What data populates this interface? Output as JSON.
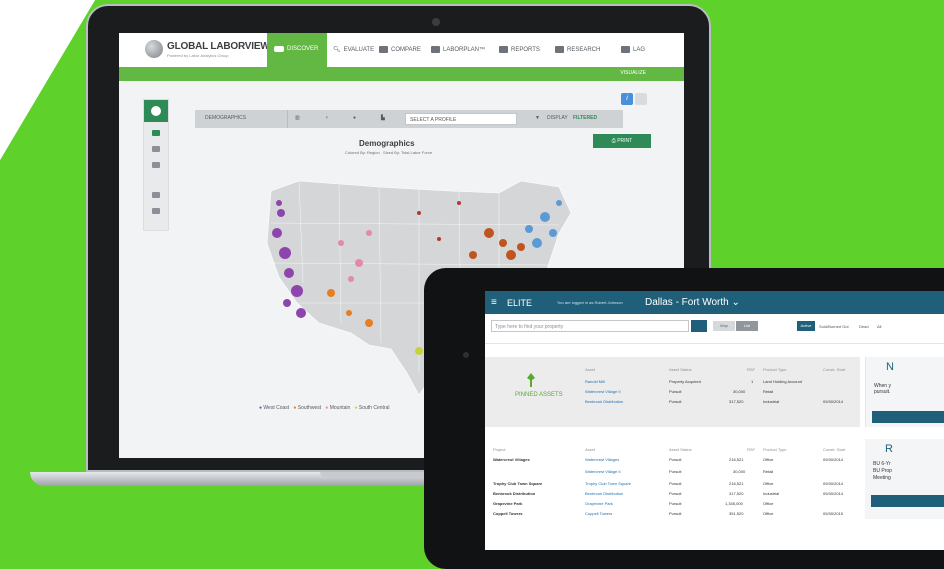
{
  "laptop": {
    "logo": {
      "title": "GLOBAL LABORVIEW",
      "subtitle": "Powered by Labor Analytics Group"
    },
    "nav": [
      {
        "label": "DISCOVER",
        "active": true
      },
      {
        "label": "EVALUATE"
      },
      {
        "label": "COMPARE"
      },
      {
        "label": "LABORPLAN™"
      },
      {
        "label": "REPORTS"
      },
      {
        "label": "RESEARCH"
      },
      {
        "label": "LAG"
      }
    ],
    "greenbar_label": "VISUALIZE",
    "toolbar": {
      "tab": "DEMOGRAPHICS",
      "select_profile": "SELECT A PROFILE",
      "display": "DISPLAY",
      "display_value": "FILTERED"
    },
    "map": {
      "title": "Demographics",
      "colored_by": "Colored By: Region",
      "sized_by": "Sized By: Total Labor Force",
      "print": "PRINT",
      "legend": [
        {
          "label": "West Coast",
          "color": "#8e44ad"
        },
        {
          "label": "Southwest",
          "color": "#e67e22"
        },
        {
          "label": "Mountain",
          "color": "#e58aa6"
        },
        {
          "label": "South Central",
          "color": "#c4d43a"
        }
      ]
    }
  },
  "tablet": {
    "brand": "ELITE",
    "user": "You are logged in as Robert Johnson",
    "city": "Dallas - Fort Worth",
    "search_placeholder": "Type here to find your property",
    "toggle_map": "Map",
    "toggle_list": "List",
    "status_tabs": [
      "Active",
      "Sold/Burned Out",
      "Dead",
      "All"
    ],
    "pinned_label": "PINNED ASSETS",
    "pinned_headers": [
      "Asset",
      "Asset Status",
      "RSF",
      "Product Type",
      "Constr. Start"
    ],
    "pinned_rows": [
      {
        "asset": "Ranold Mill",
        "status": "Property Acquired",
        "rsf": "1",
        "type": "Land Holding Account",
        "start": ""
      },
      {
        "asset": "Watercrest Village II",
        "status": "Pursuit",
        "rsf": "30,000",
        "type": "Retail",
        "start": ""
      },
      {
        "asset": "Benbrook Distribution",
        "status": "Pursuit",
        "rsf": "317,520",
        "type": "Industrial",
        "start": "09/30/2014"
      }
    ],
    "table_headers": [
      "Project",
      "Asset",
      "Asset Status",
      "RSF",
      "Product Type",
      "Constr. Start"
    ],
    "table_rows": [
      {
        "project": "Watercrest Villages",
        "asset": "Watercrest Villages",
        "status": "Pursuit",
        "rsf": "216,521",
        "type": "Office",
        "start": "09/30/2014"
      },
      {
        "project": "",
        "asset": "Watercrest Village II",
        "status": "Pursuit",
        "rsf": "30,000",
        "type": "Retail",
        "start": ""
      },
      {
        "project": "Trophy Club Town Square",
        "asset": "Trophy Club Town Square",
        "status": "Pursuit",
        "rsf": "216,521",
        "type": "Office",
        "start": "09/30/2014"
      },
      {
        "project": "Benbrook Distribution",
        "asset": "Benbrook Distribution",
        "status": "Pursuit",
        "rsf": "317,520",
        "type": "Industrial",
        "start": "09/30/2014"
      },
      {
        "project": "Grapevine Park",
        "asset": "Grapevine Park",
        "status": "Pursuit",
        "rsf": "1,345,000",
        "type": "Office",
        "start": ""
      },
      {
        "project": "Coppell Towers",
        "asset": "Coppell Towers",
        "status": "Pursuit",
        "rsf": "351,520",
        "type": "Office",
        "start": "09/30/2015"
      }
    ],
    "side_head_1": "N",
    "side_text_1": [
      "When y",
      "pursuit."
    ],
    "side_head_2": "R",
    "side_text_2": [
      "BU 6-Yr",
      "BU Prop",
      "Meeting"
    ]
  },
  "colors": {
    "green": "#63b843",
    "dark_green": "#2e8b57",
    "tablet_blue": "#1f5f7a",
    "bright_green_bg": "#5ed12a"
  }
}
